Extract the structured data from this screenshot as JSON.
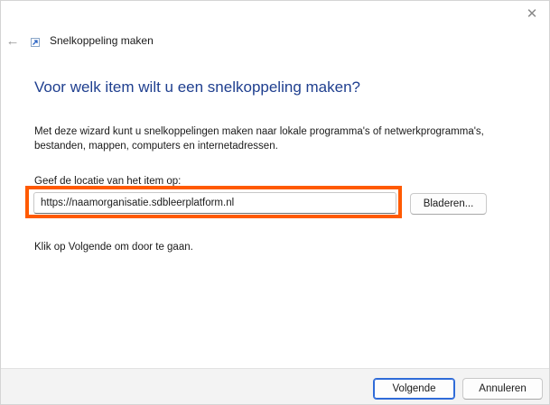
{
  "window": {
    "title": "Snelkoppeling maken",
    "close_icon": "close-icon",
    "back_icon": "back-arrow-icon",
    "title_icon": "shortcut-icon"
  },
  "main": {
    "heading": "Voor welk item wilt u een snelkoppeling maken?",
    "description": "Met deze wizard kunt u snelkoppelingen maken naar lokale programma's of netwerkprogramma's, bestanden, mappen, computers en internetadressen.",
    "location_label": "Geef de locatie van het item op:",
    "location_value": "https://naamorganisatie.sdbleerplatform.nl",
    "browse_label": "Bladeren...",
    "instruction": "Klik op Volgende om door te gaan."
  },
  "footer": {
    "next_label": "Volgende",
    "cancel_label": "Annuleren"
  },
  "colors": {
    "heading": "#1f3f8f",
    "highlight": "#ff5a00",
    "primary_border": "#2f6bd8"
  }
}
